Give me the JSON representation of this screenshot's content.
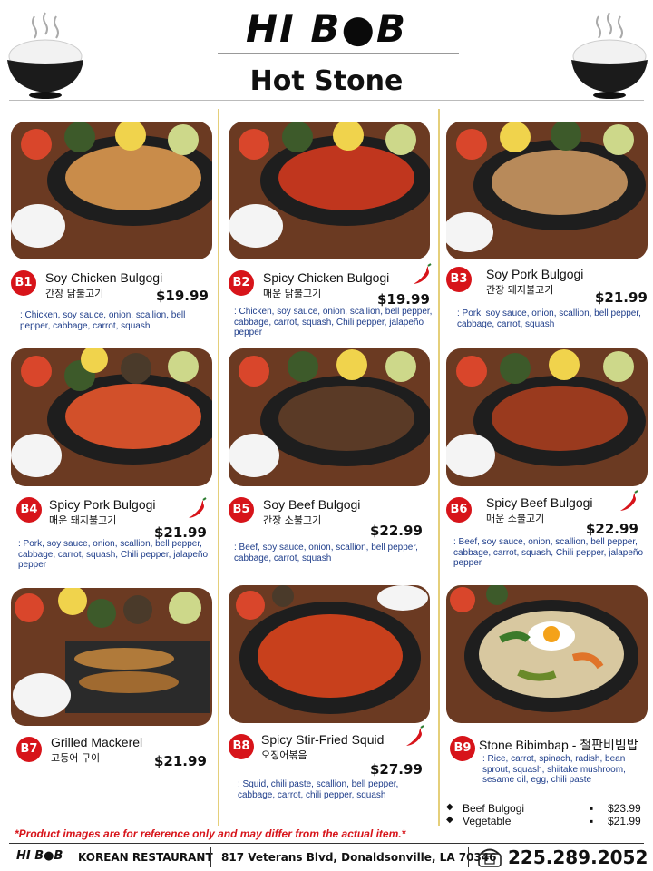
{
  "header": {
    "brand": "HI B●B",
    "page_title": "Hot Stone"
  },
  "items": [
    {
      "code": "B1",
      "name": "Soy Chicken Bulgogi",
      "korean": "간장 닭불고기",
      "price": "$19.99",
      "spicy": false,
      "desc": ": Chicken, soy sauce, onion, scallion, bell pepper, cabbage, carrot, squash"
    },
    {
      "code": "B2",
      "name": "Spicy Chicken Bulgogi",
      "korean": "매운 닭불고기",
      "price": "$19.99",
      "spicy": true,
      "desc": ": Chicken, soy sauce, onion, scallion, bell pepper, cabbage, carrot, squash, Chili pepper, jalapeño pepper"
    },
    {
      "code": "B3",
      "name": "Soy Pork Bulgogi",
      "korean": "간장 돼지불고기",
      "price": "$21.99",
      "spicy": false,
      "desc": ": Pork, soy sauce, onion, scallion, bell pepper, cabbage, carrot, squash"
    },
    {
      "code": "B4",
      "name": "Spicy Pork Bulgogi",
      "korean": "매운 돼지불고기",
      "price": "$21.99",
      "spicy": true,
      "desc": ": Pork, soy sauce, onion, scallion, bell pepper, cabbage, carrot, squash, Chili pepper, jalapeño pepper"
    },
    {
      "code": "B5",
      "name": "Soy Beef Bulgogi",
      "korean": "간장 소불고기",
      "price": "$22.99",
      "spicy": false,
      "desc": ": Beef, soy sauce, onion, scallion, bell pepper, cabbage, carrot, squash"
    },
    {
      "code": "B6",
      "name": "Spicy Beef Bulgogi",
      "korean": "매운 소불고기",
      "price": "$22.99",
      "spicy": true,
      "desc": ": Beef, soy sauce, onion, scallion, bell pepper, cabbage, carrot, squash, Chili pepper, jalapeño pepper"
    },
    {
      "code": "B7",
      "name": "Grilled Mackerel",
      "korean": "고등어 구이",
      "price": "$21.99",
      "spicy": false,
      "desc": ""
    },
    {
      "code": "B8",
      "name": "Spicy Stir-Fried Squid",
      "korean": "오징어볶음",
      "price": "$27.99",
      "spicy": true,
      "desc": ": Squid, chili paste, scallion, bell pepper, cabbage, carrot, chili pepper, squash"
    },
    {
      "code": "B9",
      "name": "Stone Bibimbap - 철판비빔밥",
      "korean": "",
      "price": "",
      "spicy": false,
      "desc": ": Rice, carrot, spinach, radish, bean sprout, squash, shiitake mushroom, sesame oil, egg, chili paste"
    }
  ],
  "bibimbap_options": [
    {
      "bullet": "◆",
      "label": "Beef Bulgogi",
      "dot": "▪",
      "price": "$23.99"
    },
    {
      "bullet": "◆",
      "label": "Vegetable",
      "dot": "▪",
      "price": "$21.99"
    }
  ],
  "disclaimer": "*Product images are for reference only and may differ from the actual item.*",
  "footer": {
    "logo": "HI B●B",
    "name": "KOREAN RESTAURANT",
    "address": "817 Veterans Blvd, Donaldsonville, LA 70346",
    "phone": "225.289.2052"
  },
  "colors": {
    "accent_red": "#d7141a",
    "desc_blue": "#1e3d8a",
    "divider_gold": "#e5cf7a"
  }
}
